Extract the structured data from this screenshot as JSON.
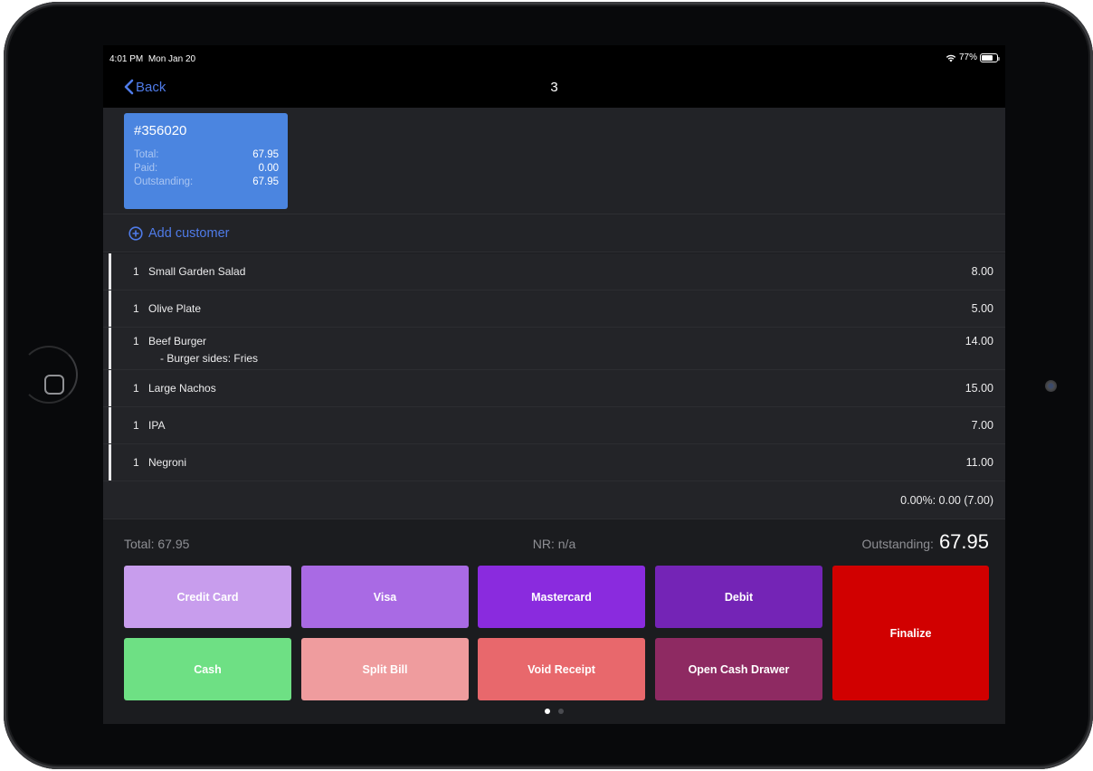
{
  "status_bar": {
    "time": "4:01 PM",
    "date": "Mon Jan 20",
    "battery": "77%",
    "battery_level": 0.77,
    "wifi_icon": "wifi-icon"
  },
  "nav": {
    "back_label": "Back",
    "title": "3"
  },
  "order_card": {
    "id": "#356020",
    "total_label": "Total:",
    "total": "67.95",
    "paid_label": "Paid:",
    "paid": "0.00",
    "outstanding_label": "Outstanding:",
    "outstanding": "67.95",
    "color": "#4b85e0"
  },
  "add_customer": {
    "label": "Add customer",
    "icon": "plus-circle-icon"
  },
  "items": [
    {
      "qty": "1",
      "name": "Small Garden Salad",
      "price": "8.00"
    },
    {
      "qty": "1",
      "name": "Olive Plate",
      "price": "5.00"
    },
    {
      "qty": "1",
      "name": "Beef Burger",
      "modifier": "- Burger sides:  Fries",
      "price": "14.00"
    },
    {
      "qty": "1",
      "name": "Large Nachos",
      "price": "15.00"
    },
    {
      "qty": "1",
      "name": "IPA",
      "price": "7.00"
    },
    {
      "qty": "1",
      "name": "Negroni",
      "price": "11.00"
    }
  ],
  "discount_line": "0.00%: 0.00 (7.00)",
  "summary": {
    "total": "Total: 67.95",
    "nr": "NR: n/a",
    "outstanding_label": "Outstanding:",
    "outstanding": "67.95"
  },
  "payment_buttons": [
    {
      "label": "Credit Card",
      "color": "#c89ded"
    },
    {
      "label": "Visa",
      "color": "#a96ae4"
    },
    {
      "label": "Mastercard",
      "color": "#8a2bde"
    },
    {
      "label": "Debit",
      "color": "#7424b6"
    },
    {
      "label": "Cash",
      "color": "#6ee084"
    },
    {
      "label": "Split Bill",
      "color": "#ef9c9e"
    },
    {
      "label": "Void Receipt",
      "color": "#e8686c"
    },
    {
      "label": "Open Cash Drawer",
      "color": "#8e2a62"
    }
  ],
  "finalize": {
    "label": "Finalize",
    "color": "#d10000"
  },
  "pager": {
    "pages": 2,
    "current": 1
  }
}
